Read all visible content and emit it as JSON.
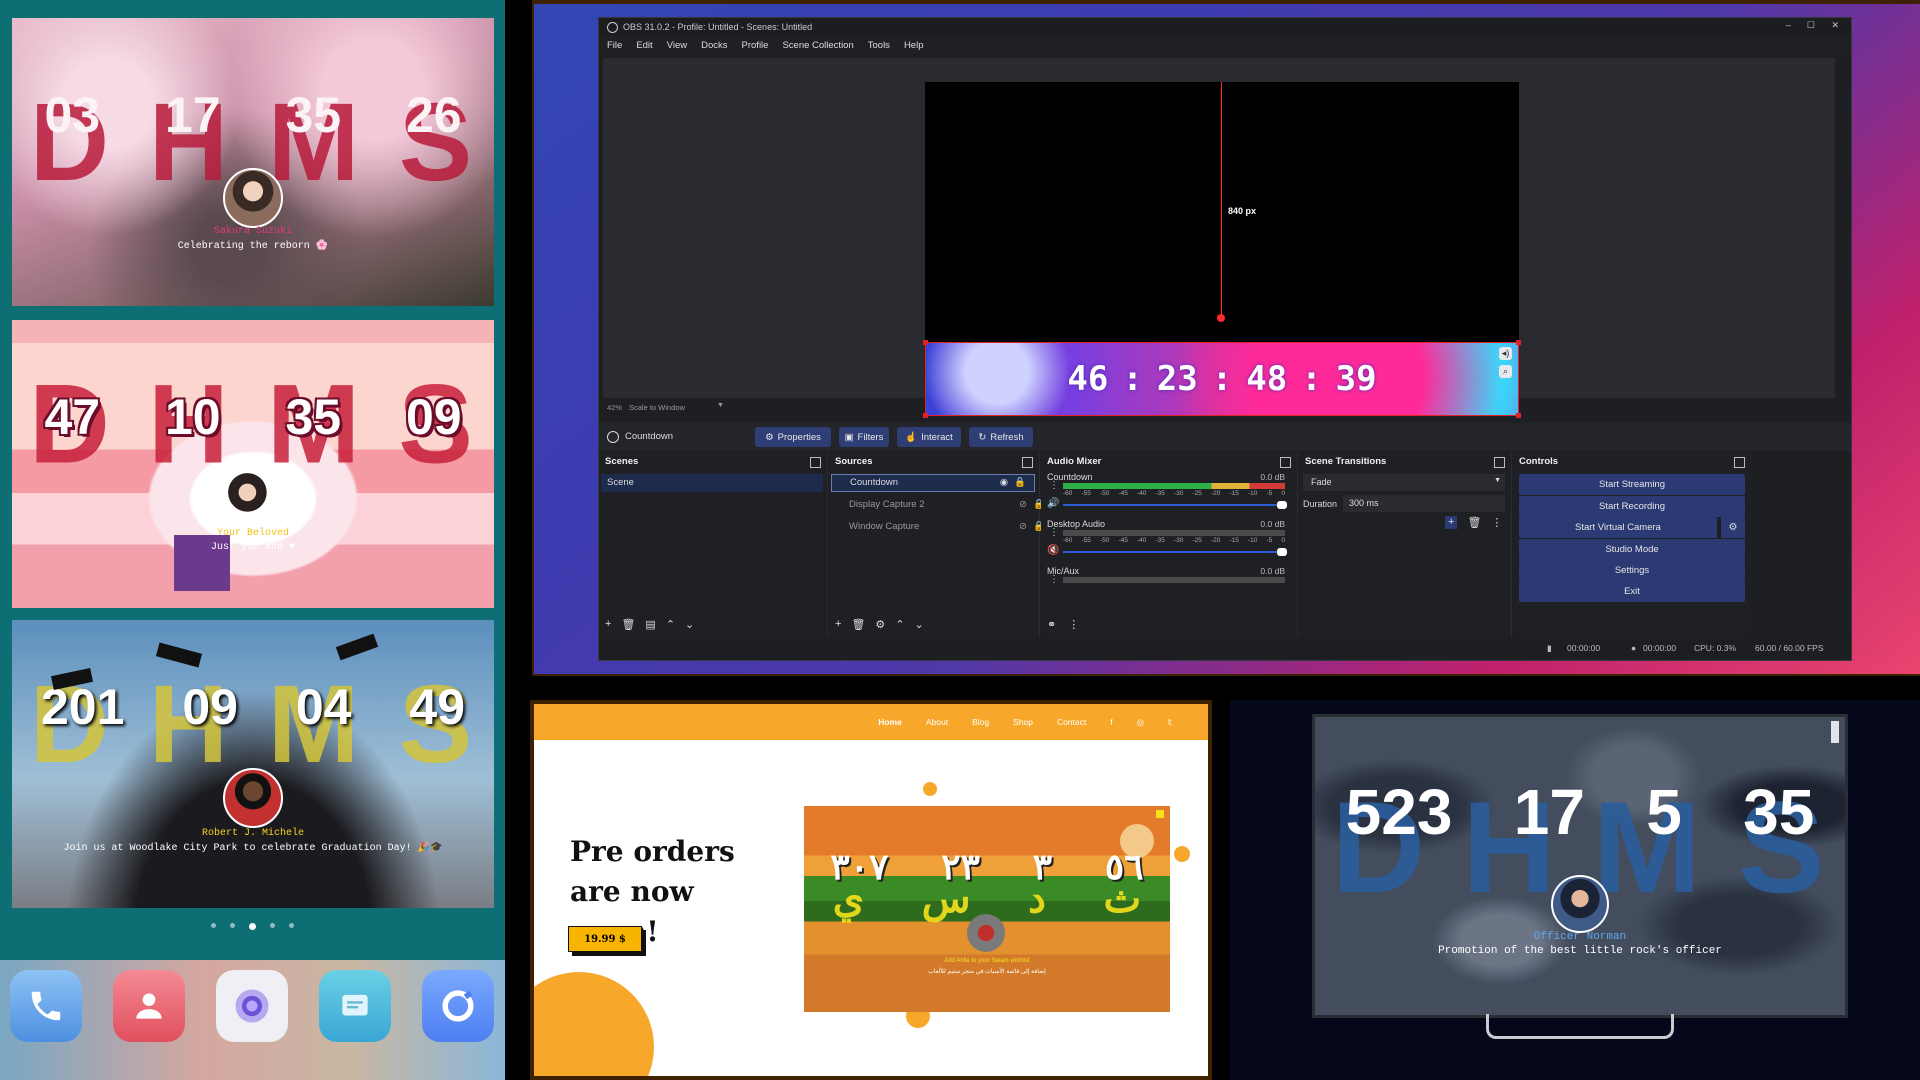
{
  "phone": {
    "card1": {
      "bg_letters": [
        "D",
        "H",
        "M",
        "S"
      ],
      "numbers": [
        "03",
        "17",
        "35",
        "26"
      ],
      "name": "Sakura Suzuki",
      "caption": "Celebrating the reborn 🌸"
    },
    "card2": {
      "bg_letters": [
        "D",
        "H",
        "M",
        "S"
      ],
      "numbers": [
        "47",
        "10",
        "35",
        "09"
      ],
      "name": "Your Beloved",
      "caption": "Just you and ♥"
    },
    "card3": {
      "bg_letters": [
        "D",
        "H",
        "M",
        "S"
      ],
      "numbers": [
        "201",
        "09",
        "04",
        "49"
      ],
      "name": "Robert J. Michele",
      "caption": "Join us at Woodlake City Park to celebrate Graduation Day! 🎉🎓"
    },
    "page_dots": 5,
    "active_dot": 2,
    "dock_apps": [
      "phone-icon",
      "contacts-icon",
      "camera-icon",
      "messages-icon",
      "browser-icon"
    ]
  },
  "obs": {
    "title": "OBS 31.0.2 - Profile: Untitled - Scenes: Untitled",
    "menu": [
      "File",
      "Edit",
      "View",
      "Docks",
      "Profile",
      "Scene Collection",
      "Tools",
      "Help"
    ],
    "measure_label": "840 px",
    "countdown": [
      "46",
      "23",
      "48",
      "39"
    ],
    "zoom": "42%",
    "scale_mode": "Scale to Window",
    "current_source": "Countdown",
    "source_buttons": [
      "Properties",
      "Filters",
      "Interact",
      "Refresh"
    ],
    "docks": {
      "scenes": {
        "title": "Scenes",
        "items": [
          "Scene"
        ]
      },
      "sources": {
        "title": "Sources",
        "items": [
          "Countdown",
          "Display Capture 2",
          "Window Capture"
        ]
      },
      "mixer": {
        "title": "Audio Mixer",
        "channels": [
          {
            "name": "Countdown",
            "db": "0.0 dB"
          },
          {
            "name": "Desktop Audio",
            "db": "0.0 dB"
          },
          {
            "name": "Mic/Aux",
            "db": "0.0 dB"
          }
        ],
        "scale": [
          "-60",
          "-55",
          "-50",
          "-45",
          "-40",
          "-35",
          "-30",
          "-25",
          "-20",
          "-15",
          "-10",
          "-5",
          "0"
        ]
      },
      "transitions": {
        "title": "Scene Transitions",
        "type": "Fade",
        "duration_label": "Duration",
        "duration": "300 ms"
      },
      "controls": {
        "title": "Controls",
        "buttons": [
          "Start Streaming",
          "Start Recording",
          "Start Virtual Camera",
          "Studio Mode",
          "Settings",
          "Exit"
        ]
      }
    },
    "status": {
      "stream_time": "00:00:00",
      "rec_time": "00:00:00",
      "cpu": "CPU: 0.3%",
      "fps": "60.00 / 60.00 FPS"
    }
  },
  "website": {
    "nav": [
      "Home",
      "About",
      "Blog",
      "Shop",
      "Contact"
    ],
    "heading": "Pre orders are now open!",
    "price": "19.99 $",
    "preview_digits": [
      "٣٠٧",
      "٢٣",
      "٣",
      "٥٦"
    ],
    "preview_letters": [
      "ي",
      "س",
      "د",
      "ث"
    ],
    "preview_caption": "Add Ahlie to your Steam wishlist",
    "preview_caption_ar": "إضافة إلى قائمة الأمنيات في متجر ستيم للألعاب"
  },
  "tv": {
    "bg_letters": [
      "D",
      "H",
      "M",
      "S"
    ],
    "numbers": [
      "523",
      "17",
      "5",
      "35"
    ],
    "name": "Officer Norman",
    "caption": "Promotion of the best little rock's officer"
  },
  "colors": {
    "obs_button": "#2c3a74",
    "web_orange": "#f7a82a",
    "card1_letters": "#b81b3b",
    "card2_letters": "#c8203a",
    "card3_letters": "#d4c53c",
    "tv_letters": "#2b5d9b"
  }
}
